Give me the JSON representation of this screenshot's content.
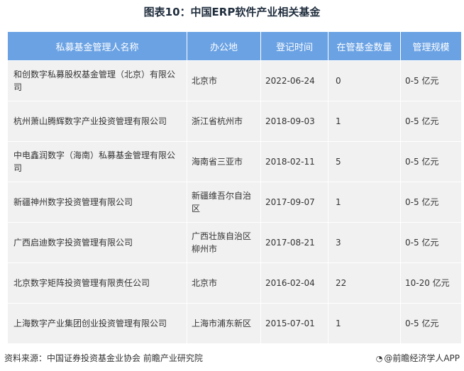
{
  "title": "图表10：中国ERP软件产业相关基金",
  "table": {
    "headers": [
      "私募基金管理人名称",
      "办公地",
      "登记时间",
      "在管基金数量",
      "管理规模"
    ],
    "rows": [
      {
        "name": "和创数字私募股权基金管理（北京）有限公司",
        "location": "北京市",
        "date": "2022-06-24",
        "count": "0",
        "scale": "0-5 亿元"
      },
      {
        "name": "杭州萧山腾辉数字产业投资管理有限公司",
        "location": "浙江省杭州市",
        "date": "2018-09-03",
        "count": "1",
        "scale": "0-5 亿元"
      },
      {
        "name": "中电鑫润数字（海南）私募基金管理有限公司",
        "location": "海南省三亚市",
        "date": "2018-02-11",
        "count": "5",
        "scale": "0-5 亿元"
      },
      {
        "name": "新疆神州数字投资管理有限公司",
        "location": "新疆维吾尔自治区",
        "date": "2017-09-07",
        "count": "1",
        "scale": "0-5 亿元"
      },
      {
        "name": "广西启迪数字投资管理有限公司",
        "location": "广西壮族自治区柳州市",
        "date": "2017-08-21",
        "count": "3",
        "scale": "0-5 亿元"
      },
      {
        "name": "北京数字矩阵投资管理有限责任公司",
        "location": "北京市",
        "date": "2016-02-04",
        "count": "22",
        "scale": "10-20 亿元"
      },
      {
        "name": "上海数字产业集团创业投资管理有限公司",
        "location": "上海市浦东新区",
        "date": "2015-07-01",
        "count": "1",
        "scale": "0-5 亿元"
      }
    ]
  },
  "footer": {
    "source": "资料来源：中国证券投资基金业协会 前瞻产业研究院",
    "brand": "@前瞻经济学人APP"
  },
  "colors": {
    "header_bg": "#6aa2e4",
    "row_bg": "#f1f1f1"
  }
}
